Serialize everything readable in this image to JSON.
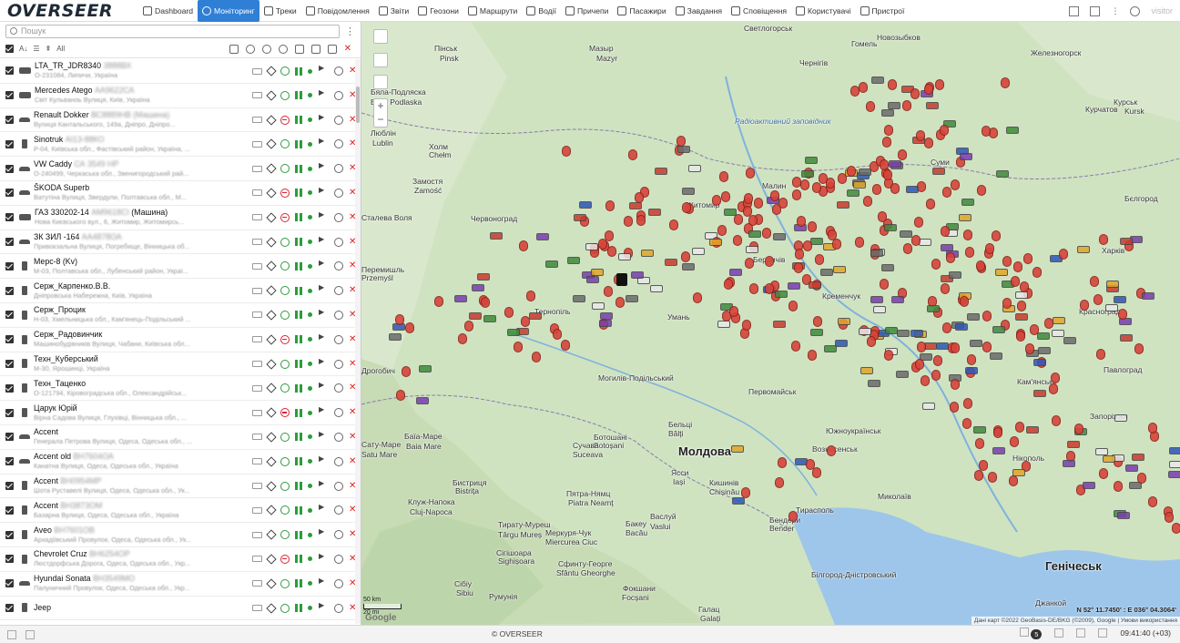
{
  "app": {
    "logo": "OVERSEER"
  },
  "nav": [
    {
      "label": "Dashboard",
      "icon": "dashboard-icon",
      "active": false
    },
    {
      "label": "Моніторинг",
      "icon": "globe-icon",
      "active": true
    },
    {
      "label": "Треки",
      "icon": "flag-icon",
      "active": false
    },
    {
      "label": "Повідомлення",
      "icon": "message-icon",
      "active": false
    },
    {
      "label": "Звіти",
      "icon": "report-icon",
      "active": false
    },
    {
      "label": "Геозони",
      "icon": "geofence-icon",
      "active": false
    },
    {
      "label": "Маршрути",
      "icon": "route-icon",
      "active": false
    },
    {
      "label": "Водії",
      "icon": "driver-icon",
      "active": false
    },
    {
      "label": "Причепи",
      "icon": "trailer-icon",
      "active": false
    },
    {
      "label": "Пасажири",
      "icon": "passenger-icon",
      "active": false
    },
    {
      "label": "Завдання",
      "icon": "task-icon",
      "active": false
    },
    {
      "label": "Сповіщення",
      "icon": "notification-icon",
      "active": false
    },
    {
      "label": "Користувачі",
      "icon": "users-icon",
      "active": false
    },
    {
      "label": "Пристрої",
      "icon": "devices-icon",
      "active": false
    }
  ],
  "topRight": {
    "user": "visitor"
  },
  "search": {
    "placeholder": "Пошук"
  },
  "toolbar": {
    "all_label": "All"
  },
  "units": [
    {
      "name": "LTA_TR_JDR8340",
      "hidden": "3888ВХ",
      "addr": "О-231084, Липичи, Україна",
      "status": "green",
      "icon": "truck"
    },
    {
      "name": "Mercedes Atego",
      "hidden": "АА9622СА",
      "addr": "Світ Кульваноь Вулиця, Київ, Україна",
      "status": "green",
      "icon": "truck"
    },
    {
      "name": "Renault Dokker",
      "hidden": "ВС8889НВ (Машина)",
      "addr": "Вулиця Кантальського, 149а, Дніпро, Дніпро...",
      "status": "red",
      "icon": "car"
    },
    {
      "name": "Sinotruk",
      "hidden": "АІ13-88КО",
      "addr": "Р-04, Київська обл., Фастівський район, Україна, ...",
      "status": "green",
      "icon": "phone"
    },
    {
      "name": "VW Caddy",
      "hidden": "СА 3549 НР",
      "addr": "О-240499, Черкаська обл., Звенигородський рай...",
      "status": "green",
      "icon": "car"
    },
    {
      "name": "ŠKODA Superb",
      "hidden": "",
      "addr": "Ватутіна Вулиця, Звердули, Полтавська обл., М...",
      "status": "red",
      "icon": "car"
    },
    {
      "name": "ГАЗ 330202-14",
      "hidden": "АМ9618СІ",
      "name2": "(Машина)",
      "addr": "Нова Києвського вул., 6, Житомир, Житомирсь...",
      "status": "red",
      "icon": "truck"
    },
    {
      "name": "ЗК ЗИЛ -164",
      "hidden": "АА4878ОА",
      "addr": "Привокзальна Вулиця, Погребище, Вінницька об...",
      "status": "green",
      "icon": "car"
    },
    {
      "name": "Мерс-8 (Kv)",
      "hidden": "",
      "addr": "М-03, Полтавська обл., Лубенський район, Украї...",
      "status": "green",
      "icon": "phone"
    },
    {
      "name": "Серж_Карпенко.В.В.",
      "hidden": "",
      "addr": "Дніпровська Набережна, Київ, Україна",
      "status": "green",
      "icon": "phone"
    },
    {
      "name": "Серж_Процик",
      "hidden": "",
      "addr": "Н-03, Хмельницька обл., Кам'янець-Подільський ...",
      "status": "green",
      "icon": "phone"
    },
    {
      "name": "Серж_Радовинчик",
      "hidden": "",
      "addr": "Машинобудівників Вулиця, Чабани, Київська обл...",
      "status": "red",
      "icon": "phone"
    },
    {
      "name": "Техн_Куберський",
      "hidden": "",
      "addr": "М-30, Ярошинці, Україна",
      "status": "green",
      "icon": "phone"
    },
    {
      "name": "Техн_Таценко",
      "hidden": "",
      "addr": "О-121794, Кіровоградська обл., Олександрійськ...",
      "status": "green",
      "icon": "phone"
    },
    {
      "name": "Царук Юрій",
      "hidden": "",
      "addr": "Вірна Садова Вулиця, Глухівці, Вінницька обл., ...",
      "status": "red",
      "icon": "phone"
    },
    {
      "name": "Accent",
      "hidden": "",
      "addr": "Генерала Петрова Вулиця, Одеса, Одеська обл., ...",
      "status": "green",
      "icon": "car"
    },
    {
      "name": "Accent old",
      "hidden": "ВН7604ОА",
      "addr": "Канатна Вулиця, Одеса, Одеська обл., Україна",
      "status": "green",
      "icon": "car"
    },
    {
      "name": "Accent",
      "hidden": "ВН0954МР",
      "addr": "Шота Руставелі Вулиця, Одеса, Одеська обл., Ук...",
      "status": "green",
      "icon": "phone"
    },
    {
      "name": "Accent",
      "hidden": "ВН3873ОМ",
      "addr": "Базарна Вулиця, Одеса, Одеська обл., Україна",
      "status": "green",
      "icon": "phone"
    },
    {
      "name": "Aveo",
      "hidden": "ВН7601ОВ",
      "addr": "Архадіївський Провулок, Одеса, Одеська обл., Ук...",
      "status": "green",
      "icon": "phone"
    },
    {
      "name": "Chevrolet Cruz",
      "hidden": "ВН6254ОР",
      "addr": "Люстдорфська Дорога, Одеса, Одеська обл., Укр...",
      "status": "red",
      "icon": "phone"
    },
    {
      "name": "Hyundai Sonata",
      "hidden": "ВН3549МО",
      "addr": "Палуничний Провулок, Одеса, Одеська обл., Укр...",
      "status": "green",
      "icon": "car"
    },
    {
      "name": "Jeep",
      "hidden": "",
      "addr": "",
      "status": "green",
      "icon": "phone"
    }
  ],
  "map": {
    "labels": [
      {
        "t": "Светлогорськ"
      },
      {
        "t": "Гомель"
      },
      {
        "t": "Новозыбков"
      },
      {
        "t": "Железногорск"
      },
      {
        "t": "Пінськ"
      },
      {
        "t": "Pinsk"
      },
      {
        "t": "Мазыр"
      },
      {
        "t": "Mazyr"
      },
      {
        "t": "Чернігів"
      },
      {
        "t": "Курськ"
      },
      {
        "t": "Kursk"
      },
      {
        "t": "Бяла-Подляска"
      },
      {
        "t": "Biała Podlaska"
      },
      {
        "t": "Курчатов"
      },
      {
        "t": "Радіоактивний заповідник"
      },
      {
        "t": "Люблін"
      },
      {
        "t": "Lublin"
      },
      {
        "t": "Холм"
      },
      {
        "t": "Chełm"
      },
      {
        "t": "Суми"
      },
      {
        "t": "Замостя"
      },
      {
        "t": "Zamość"
      },
      {
        "t": "Малин"
      },
      {
        "t": "Бєлгород"
      },
      {
        "t": "Сталева Воля"
      },
      {
        "t": "Червоноград"
      },
      {
        "t": "Житомир"
      },
      {
        "t": "Харків"
      },
      {
        "t": "Перемишль"
      },
      {
        "t": "Przemyśl"
      },
      {
        "t": "Бердичів"
      },
      {
        "t": "Кременчук"
      },
      {
        "t": "Красноград"
      },
      {
        "t": "Тернопіль"
      },
      {
        "t": "Умань"
      },
      {
        "t": "Павлоград"
      },
      {
        "t": "Дрогобич"
      },
      {
        "t": "Кам'янське"
      },
      {
        "t": "Запоріжжя"
      },
      {
        "t": "Могилів-Подільський"
      },
      {
        "t": "Первомайськ"
      },
      {
        "t": "Южноукраїнськ"
      },
      {
        "t": "Бельці"
      },
      {
        "t": "Bălți"
      },
      {
        "t": "Ботошані"
      },
      {
        "t": "Botoșani"
      },
      {
        "t": "Вознесенськ"
      },
      {
        "t": "Сучава"
      },
      {
        "t": "Suceava"
      },
      {
        "t": "Баїа-Маре"
      },
      {
        "t": "Baia Mare"
      },
      {
        "t": "Сату-Маре"
      },
      {
        "t": "Satu Mare"
      },
      {
        "t": "Молдова"
      },
      {
        "t": "Нікополь"
      },
      {
        "t": "Ясси"
      },
      {
        "t": "Iași"
      },
      {
        "t": "Кишинів"
      },
      {
        "t": "Chișinău"
      },
      {
        "t": "Миколаїв"
      },
      {
        "t": "Бистриця"
      },
      {
        "t": "Bistrița"
      },
      {
        "t": "Пятра-Нямц"
      },
      {
        "t": "Piatra Neamț"
      },
      {
        "t": "Клуж-Напока"
      },
      {
        "t": "Cluj-Napoca"
      },
      {
        "t": "Тирату-Муреш"
      },
      {
        "t": "Târgu Mureș"
      },
      {
        "t": "Бакеу"
      },
      {
        "t": "Bacău"
      },
      {
        "t": "Васлуй"
      },
      {
        "t": "Vaslui"
      },
      {
        "t": "Тирасполь"
      },
      {
        "t": "Бендери"
      },
      {
        "t": "Bender"
      },
      {
        "t": "Меркуря-Чук"
      },
      {
        "t": "Miercurea Ciuc"
      },
      {
        "t": "Сігішоара"
      },
      {
        "t": "Sighișoara"
      },
      {
        "t": "Сфинту-Георге"
      },
      {
        "t": "Sfântu Gheorghe"
      },
      {
        "t": "Сібіу"
      },
      {
        "t": "Sibiu"
      },
      {
        "t": "Фокшани"
      },
      {
        "t": "Focșani"
      },
      {
        "t": "Галац"
      },
      {
        "t": "Galați"
      },
      {
        "t": "Румунія"
      },
      {
        "t": "Білгород-Дністровський"
      },
      {
        "t": "Генічеськ"
      },
      {
        "t": "Джанкой"
      }
    ],
    "scale_km": "50 km",
    "scale_mi": "20 mi",
    "coords": "N 52° 11.7450' : E 036° 04.3064'",
    "attribution": "Дані карт ©2022 GeoBasis-DE/BKG (©2009), Google  |  Умови використання",
    "google": "Google"
  },
  "status": {
    "copyright": "© OVERSEER",
    "badge": "5",
    "time": "09:41:40 (+03)"
  },
  "colors": {
    "accent": "#2f7fd6",
    "marker": "#d6443a",
    "land": "#cfe3c1",
    "water": "#9ec6ea"
  }
}
